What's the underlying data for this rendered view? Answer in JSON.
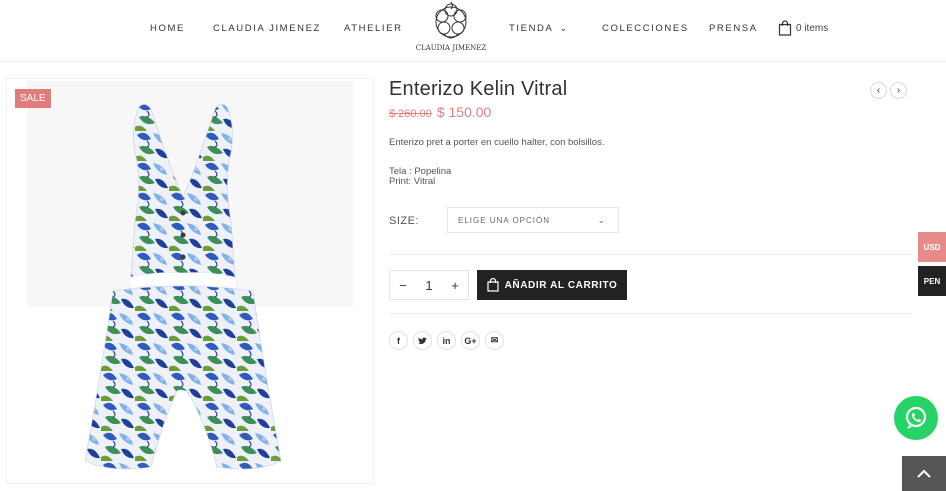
{
  "nav": {
    "items": [
      {
        "label": "HOME"
      },
      {
        "label": "CLAUDIA JIMENEZ"
      },
      {
        "label": "ATHELIER"
      },
      {
        "label": "TIENDA"
      },
      {
        "label": "COLECCIONES"
      },
      {
        "label": "PRENSA"
      }
    ],
    "logo_text": "CLAUDIA  JIMENEZ",
    "cart_label": "0 items"
  },
  "product": {
    "sale_badge": "SALE",
    "title": "Enterizo Kelin Vitral",
    "old_price": "$ 260.00",
    "new_price": "$ 150.00",
    "description": "Enterizo pret a porter en cuello halter, con bolsillos.",
    "fabric": "Tela : Popelina",
    "print": "Print: Vitral",
    "size_label": "SIZE:",
    "size_placeholder": "ELIGE UNA OPCIÓN",
    "quantity": "1",
    "add_to_cart": "AÑADIR AL CARRITO"
  },
  "share": [
    {
      "icon": "facebook-icon",
      "glyph": "f"
    },
    {
      "icon": "twitter-icon",
      "glyph": "t"
    },
    {
      "icon": "linkedin-icon",
      "glyph": "in"
    },
    {
      "icon": "google-plus-icon",
      "glyph": "G+"
    },
    {
      "icon": "email-icon",
      "glyph": "✉"
    }
  ],
  "currency": {
    "usd": "USD",
    "pen": "PEN"
  },
  "colors": {
    "accent": "#e27c7c",
    "dark": "#222222",
    "whatsapp": "#25d366"
  }
}
